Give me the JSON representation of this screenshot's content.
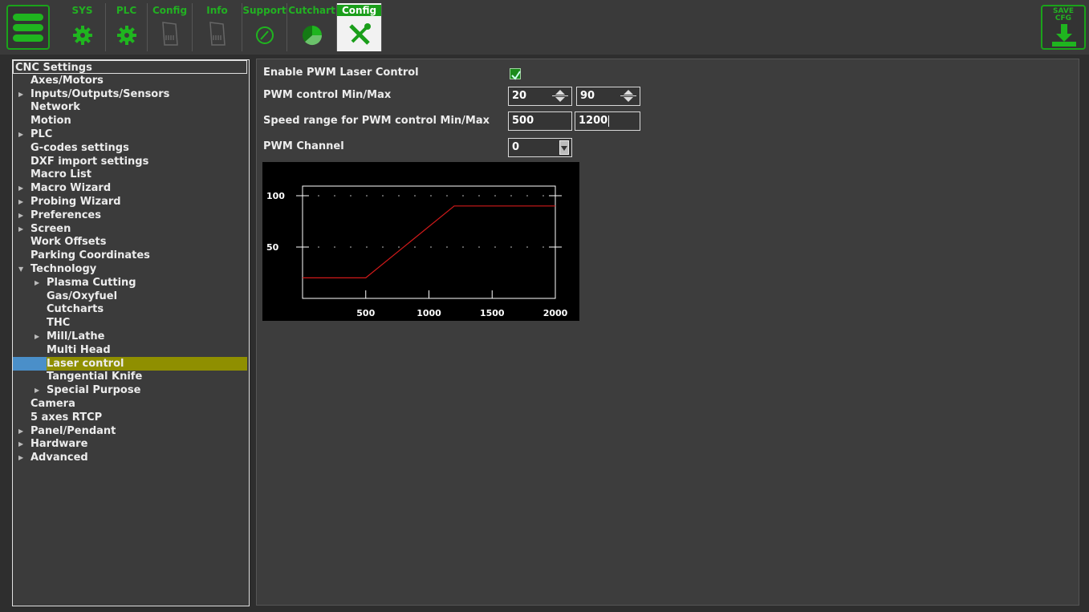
{
  "topbar": {
    "tabs": [
      {
        "label": "SYS",
        "icon": "gear-icon"
      },
      {
        "label": "PLC",
        "icon": "gear-icon"
      },
      {
        "label": "Config",
        "icon": "document-icon"
      },
      {
        "label": "Info",
        "icon": "document-icon"
      },
      {
        "label": "Support",
        "icon": "gauge-icon"
      },
      {
        "label": "Cutchart",
        "icon": "pie-chart-icon"
      },
      {
        "label": "Config",
        "icon": "tools-icon",
        "active": true
      }
    ],
    "save_label_1": "SAVE",
    "save_label_2": "CFG"
  },
  "tree": {
    "items": [
      {
        "label": "CNC Settings",
        "level": 0,
        "arrow": "",
        "root": true
      },
      {
        "label": "Axes/Motors",
        "level": 1,
        "arrow": ""
      },
      {
        "label": "Inputs/Outputs/Sensors",
        "level": 1,
        "arrow": "right"
      },
      {
        "label": "Network",
        "level": 1,
        "arrow": ""
      },
      {
        "label": "Motion",
        "level": 1,
        "arrow": ""
      },
      {
        "label": "PLC",
        "level": 1,
        "arrow": "right"
      },
      {
        "label": "G-codes settings",
        "level": 1,
        "arrow": ""
      },
      {
        "label": "DXF import settings",
        "level": 1,
        "arrow": ""
      },
      {
        "label": "Macro List",
        "level": 1,
        "arrow": ""
      },
      {
        "label": "Macro Wizard",
        "level": 1,
        "arrow": "right"
      },
      {
        "label": "Probing Wizard",
        "level": 1,
        "arrow": "right"
      },
      {
        "label": "Preferences",
        "level": 1,
        "arrow": "right"
      },
      {
        "label": "Screen",
        "level": 1,
        "arrow": "right"
      },
      {
        "label": "Work Offsets",
        "level": 1,
        "arrow": ""
      },
      {
        "label": "Parking Coordinates",
        "level": 1,
        "arrow": ""
      },
      {
        "label": "Technology",
        "level": 1,
        "arrow": "down"
      },
      {
        "label": "Plasma Cutting",
        "level": 2,
        "arrow": "right"
      },
      {
        "label": "Gas/Oxyfuel",
        "level": 2,
        "arrow": ""
      },
      {
        "label": "Cutcharts",
        "level": 2,
        "arrow": ""
      },
      {
        "label": "THC",
        "level": 2,
        "arrow": ""
      },
      {
        "label": "Mill/Lathe",
        "level": 2,
        "arrow": "right"
      },
      {
        "label": "Multi Head",
        "level": 2,
        "arrow": ""
      },
      {
        "label": "Laser control",
        "level": 2,
        "arrow": "",
        "selected": true
      },
      {
        "label": "Tangential Knife",
        "level": 2,
        "arrow": ""
      },
      {
        "label": "Special Purpose",
        "level": 2,
        "arrow": "right"
      },
      {
        "label": "Camera",
        "level": 1,
        "arrow": ""
      },
      {
        "label": "5 axes RTCP",
        "level": 1,
        "arrow": ""
      },
      {
        "label": "Panel/Pendant",
        "level": 1,
        "arrow": "right"
      },
      {
        "label": "Hardware",
        "level": 1,
        "arrow": "right"
      },
      {
        "label": "Advanced",
        "level": 1,
        "arrow": "right"
      }
    ]
  },
  "settings": {
    "enable_label": "Enable PWM Laser Control",
    "enable_checked": true,
    "pwm_label": "PWM control Min/Max",
    "pwm_min": "20",
    "pwm_max": "90",
    "speed_label": "Speed range for PWM control Min/Max",
    "speed_min": "500",
    "speed_max": "1200",
    "channel_label": "PWM Channel",
    "channel_value": "0"
  },
  "colors": {
    "accent": "#1aa31a",
    "selection": "#8f8f00",
    "curve": "#d11a1a"
  },
  "chart_data": {
    "type": "line",
    "title": "",
    "xlabel": "",
    "ylabel": "",
    "xlim": [
      0,
      2000
    ],
    "ylim": [
      0,
      120
    ],
    "x_ticks": [
      500,
      1000,
      1500,
      2000
    ],
    "y_ticks": [
      50,
      100
    ],
    "grid": true,
    "series": [
      {
        "x": [
          0,
          500,
          1200,
          2000
        ],
        "y": [
          20,
          20,
          90,
          90
        ]
      }
    ]
  }
}
